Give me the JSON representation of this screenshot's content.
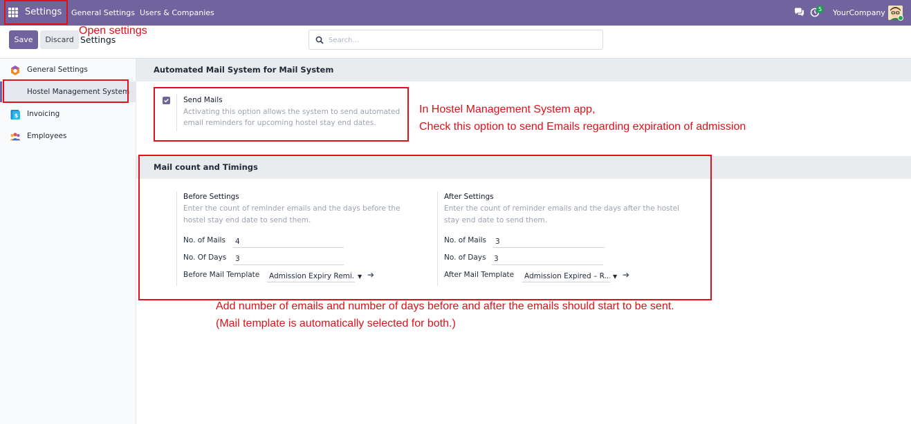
{
  "navbar": {
    "app_name": "Settings",
    "links": [
      "General Settings",
      "Users & Companies"
    ],
    "notification_count": "5",
    "company": "YourCompany",
    "icons": [
      "apps-grid-icon",
      "chat-icon",
      "activity-clock-icon",
      "user-avatar"
    ],
    "color": "#71639e"
  },
  "control": {
    "save_label": "Save",
    "discard_label": "Discard",
    "breadcrumb": "Settings",
    "search_placeholder": "Search..."
  },
  "sidebar": {
    "items": [
      {
        "label": "General Settings",
        "icon": "odoo-cog-icon"
      },
      {
        "label": "Hostel Management System",
        "icon": ""
      },
      {
        "label": "Invoicing",
        "icon": "invoice-dollar-icon"
      },
      {
        "label": "Employees",
        "icon": "employees-group-icon"
      }
    ],
    "active_index": 1
  },
  "section1": {
    "title": "Automated Mail System for Mail System",
    "send_mails": {
      "title": "Send Mails",
      "desc_line1": "Activating this option allows the system to send automated",
      "desc_line2": "email reminders for upcoming hostel stay end dates.",
      "checked": true
    }
  },
  "section2": {
    "title": "Mail count and Timings",
    "before": {
      "title": "Before Settings",
      "desc_line1": "Enter the count of reminder emails and the days before the",
      "desc_line2": "hostel stay end date to send them.",
      "mails_label": "No. of Mails",
      "mails_value": "4",
      "days_label": "No. Of Days",
      "days_value": "3",
      "template_label": "Before Mail Template",
      "template_value": "Admission Expiry Remi..."
    },
    "after": {
      "title": "After Settings",
      "desc_line1": "Enter the count of reminder emails and the days after the hostel",
      "desc_line2": "stay end date to send them.",
      "mails_label": "No. of Mails",
      "mails_value": "3",
      "days_label": "No. of Days",
      "days_value": "3",
      "template_label": "After Mail Template",
      "template_value": "Admission Expired – R..."
    }
  },
  "annotations": {
    "open_settings": "Open settings",
    "hostel_line1": "In Hostel Management System app,",
    "hostel_line2": "Check this option to send Emails regarding expiration of admission",
    "bottom_line1": "Add number of emails and number of days before and after the emails should start to be sent.",
    "bottom_line2": "(Mail template is automatically selected for both.)",
    "color": "#e0101a"
  }
}
